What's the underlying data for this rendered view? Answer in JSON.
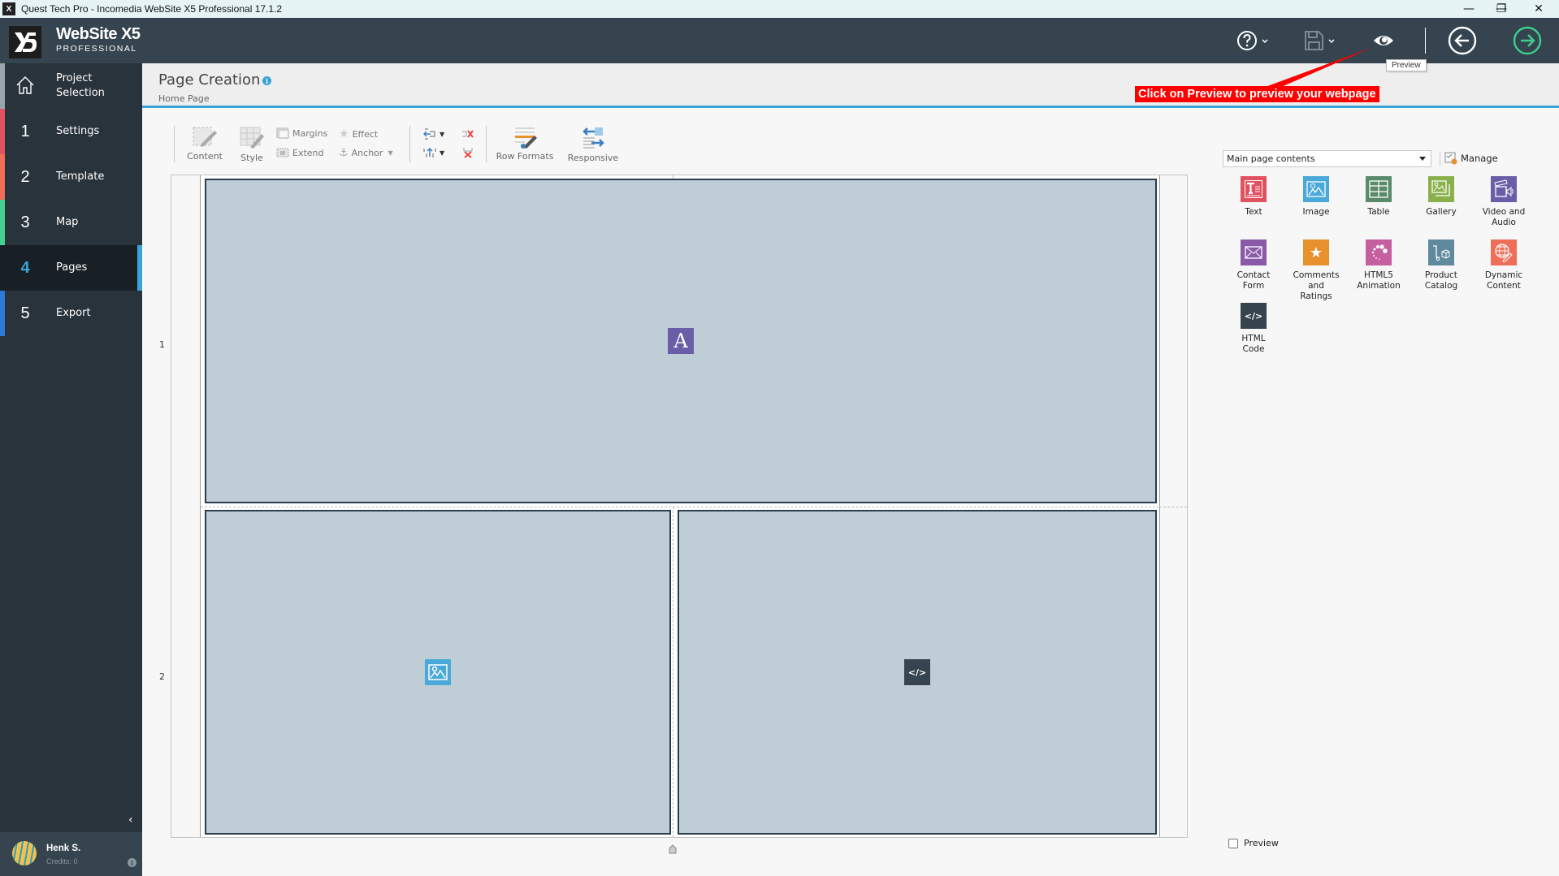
{
  "window": {
    "title": "Quest Tech Pro - Incomedia WebSite X5 Professional 17.1.2",
    "controls": {
      "minimize": "—",
      "maximize": "❐",
      "close": "✕"
    }
  },
  "header": {
    "logo_mark": "X5",
    "brand_name": "WebSite X5",
    "brand_edition": "PROFESSIONAL",
    "buttons": [
      {
        "name": "help",
        "icon": "help-circle-icon"
      },
      {
        "name": "save",
        "icon": "floppy-disk-icon"
      },
      {
        "name": "preview",
        "icon": "eye-icon"
      },
      {
        "name": "back",
        "icon": "arrow-left-circle-icon"
      },
      {
        "name": "next",
        "icon": "arrow-right-circle-icon"
      }
    ],
    "tooltip": "Preview",
    "colors": {
      "bg": "#35444e",
      "next_accent": "#3ecf8e"
    }
  },
  "annotation": {
    "callout_text": "Click on Preview to preview your webpage",
    "color": "#ff0000"
  },
  "sidebar": {
    "items": [
      {
        "num": "",
        "icon": "home-icon",
        "label": "Project\nSelection",
        "color": "#9aa5ab",
        "active": false
      },
      {
        "num": "1",
        "label": "Settings",
        "color": "#e05260",
        "active": false
      },
      {
        "num": "2",
        "label": "Template",
        "color": "#ef6e57",
        "active": false
      },
      {
        "num": "3",
        "label": "Map",
        "color": "#45d18f",
        "active": false
      },
      {
        "num": "4",
        "label": "Pages",
        "color": "#3aa3d8",
        "active": true
      },
      {
        "num": "5",
        "label": "Export",
        "color": "#2a7ad6",
        "active": false
      }
    ],
    "collapse_glyph": "‹",
    "user": {
      "name": "Henk S.",
      "credits": "Credits: 0",
      "info_glyph": "i"
    }
  },
  "page": {
    "title": "Page Creation",
    "info_glyph": "i",
    "subtitle": "Home Page"
  },
  "toolbar": {
    "content": "Content",
    "style": "Style",
    "margins": "Margins",
    "extend": "Extend",
    "effect": "Effect",
    "anchor": "Anchor",
    "row_formats": "Row Formats",
    "responsive": "Responsive"
  },
  "canvas": {
    "rows": [
      {
        "label": "1",
        "cells": [
          {
            "object": "text",
            "glyph": "A",
            "color": "#6b5ea8"
          }
        ]
      },
      {
        "label": "2",
        "cells": [
          {
            "object": "image",
            "color": "#4aa9d8"
          },
          {
            "object": "html-code",
            "glyph": "</>",
            "color": "#35444e"
          }
        ]
      }
    ]
  },
  "objects_panel": {
    "category_selected": "Main page contents",
    "manage_label": "Manage",
    "items": [
      {
        "id": "text",
        "label": "Text",
        "color": "#e05260"
      },
      {
        "id": "image",
        "label": "Image",
        "color": "#4aa9d8"
      },
      {
        "id": "table",
        "label": "Table",
        "color": "#5a8a6a"
      },
      {
        "id": "gallery",
        "label": "Gallery",
        "color": "#8ab04c"
      },
      {
        "id": "video-audio",
        "label": "Video and\nAudio",
        "color": "#6b5ea8"
      },
      {
        "id": "contact-form",
        "label": "Contact\nForm",
        "color": "#8a5aa8"
      },
      {
        "id": "comments-ratings",
        "label": "Comments\nand\nRatings",
        "color": "#e8902e"
      },
      {
        "id": "html5-animation",
        "label": "HTML5\nAnimation",
        "color": "#c65fa0"
      },
      {
        "id": "product-catalog",
        "label": "Product\nCatalog",
        "color": "#5f8a9e"
      },
      {
        "id": "dynamic-content",
        "label": "Dynamic\nContent",
        "color": "#ef6e57"
      },
      {
        "id": "html-code",
        "label": "HTML\nCode",
        "color": "#35444e"
      }
    ],
    "preview_checkbox": {
      "label": "Preview",
      "checked": false
    }
  }
}
